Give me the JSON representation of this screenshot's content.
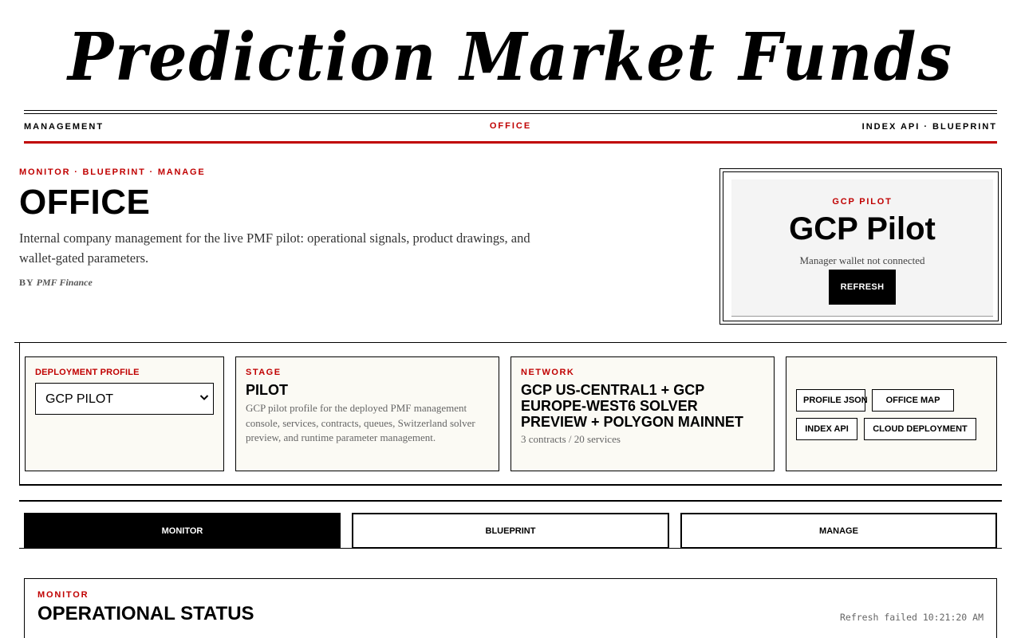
{
  "masthead": {
    "title": "Prediction Market Funds"
  },
  "nav": {
    "left": "MANAGEMENT",
    "center": "OFFICE",
    "right": "INDEX API · BLUEPRINT"
  },
  "hero": {
    "kicker": "MONITOR · BLUEPRINT · MANAGE",
    "title": "OFFICE",
    "description": "Internal company management for the live PMF pilot: operational signals, product drawings, and wallet-gated parameters.",
    "byline_prefix": "BY",
    "byline_author": "PMF Finance"
  },
  "pilot_card": {
    "kicker": "GCP PILOT",
    "title": "GCP Pilot",
    "status": "Manager wallet not connected",
    "refresh_label": "REFRESH"
  },
  "deployment": {
    "label": "DEPLOYMENT PROFILE",
    "selected": "GCP PILOT"
  },
  "stage": {
    "label": "STAGE",
    "value": "PILOT",
    "note": "GCP pilot profile for the deployed PMF management console, services, contracts, queues, Switzerland solver preview, and runtime parameter management."
  },
  "network": {
    "label": "NETWORK",
    "value": "GCP US-CENTRAL1 + GCP EUROPE-WEST6 SOLVER PREVIEW + POLYGON MAINNET",
    "summary": "3 contracts / 20 services"
  },
  "links": {
    "profile_json": "PROFILE JSON",
    "office_map": "OFFICE MAP",
    "index_api": "INDEX API",
    "cloud_deployment": "CLOUD DEPLOYMENT"
  },
  "tabs": [
    {
      "label": "MONITOR",
      "active": true
    },
    {
      "label": "BLUEPRINT",
      "active": false
    },
    {
      "label": "MANAGE",
      "active": false
    }
  ],
  "status_section": {
    "kicker": "MONITOR",
    "title": "OPERATIONAL STATUS",
    "refresh_text": "Refresh failed 10:21:20 AM"
  },
  "colors": {
    "accent_red": "#c00000",
    "ink": "#000000",
    "card_bg": "#fbfaf4",
    "panel_bg": "#f4f4f4"
  },
  "icons": {
    "select_arrow": "chevron-down-icon"
  }
}
